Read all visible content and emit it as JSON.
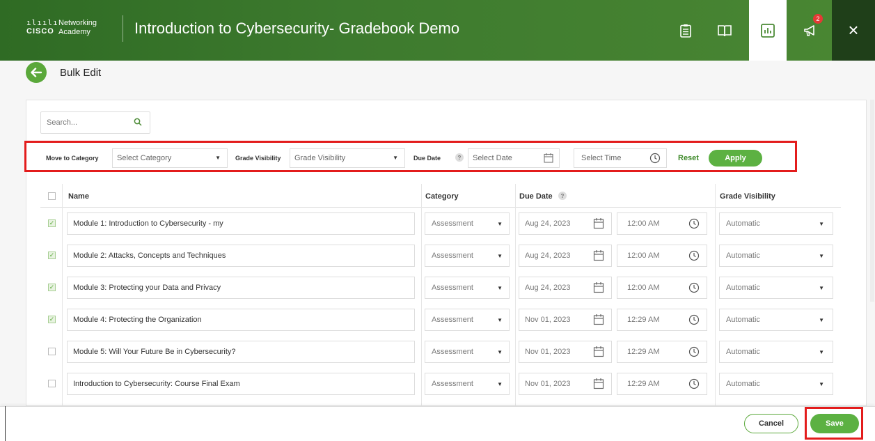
{
  "header": {
    "logo_marks": "ılıılı",
    "logo_brand": "CISCO",
    "logo_line1": "Networking",
    "logo_line2": "Academy",
    "title": "Introduction to Cybersecurity- Gradebook Demo",
    "notification_count": "2",
    "icons": [
      "clipboard-icon",
      "book-icon",
      "gradebook-icon",
      "megaphone-icon",
      "close-icon"
    ],
    "close_label": "×"
  },
  "page": {
    "title": "Bulk Edit"
  },
  "search": {
    "placeholder": "Search..."
  },
  "bulk_bar": {
    "move_label": "Move to Category",
    "category_value": "Select Category",
    "visibility_label": "Grade Visibility",
    "visibility_value": "Grade Visibility",
    "due_label": "Due Date",
    "help": "?",
    "date_value": "Select Date",
    "time_value": "Select Time",
    "reset_label": "Reset",
    "apply_label": "Apply"
  },
  "table": {
    "headers": {
      "name": "Name",
      "category": "Category",
      "due_date": "Due Date",
      "visibility": "Grade Visibility"
    },
    "rows": [
      {
        "checked": true,
        "name": " Module 1: Introduction to Cybersecurity - my",
        "category": "Assessment",
        "date": "Aug 24, 2023",
        "time": "12:00 AM",
        "visibility": "Automatic"
      },
      {
        "checked": true,
        "name": "Module 2: Attacks, Concepts and Techniques",
        "category": "Assessment",
        "date": "Aug 24, 2023",
        "time": "12:00 AM",
        "visibility": "Automatic"
      },
      {
        "checked": true,
        "name": "Module 3: Protecting your Data and Privacy",
        "category": "Assessment",
        "date": "Aug 24, 2023",
        "time": "12:00 AM",
        "visibility": "Automatic"
      },
      {
        "checked": true,
        "name": "Module 4: Protecting the Organization",
        "category": "Assessment",
        "date": "Nov 01, 2023",
        "time": "12:29 AM",
        "visibility": "Automatic"
      },
      {
        "checked": false,
        "name": "Module 5: Will Your Future Be in Cybersecurity?",
        "category": "Assessment",
        "date": "Nov 01, 2023",
        "time": "12:29 AM",
        "visibility": "Automatic"
      },
      {
        "checked": false,
        "name": "Introduction to Cybersecurity: Course Final Exam",
        "category": "Assessment",
        "date": "Nov 01, 2023",
        "time": "12:29 AM",
        "visibility": "Automatic"
      }
    ]
  },
  "footer": {
    "cancel_label": "Cancel",
    "save_label": "Save"
  },
  "colors": {
    "brand_green": "#5cb142",
    "header_green": "#3d7a2e",
    "highlight_red": "#e31c1c"
  }
}
